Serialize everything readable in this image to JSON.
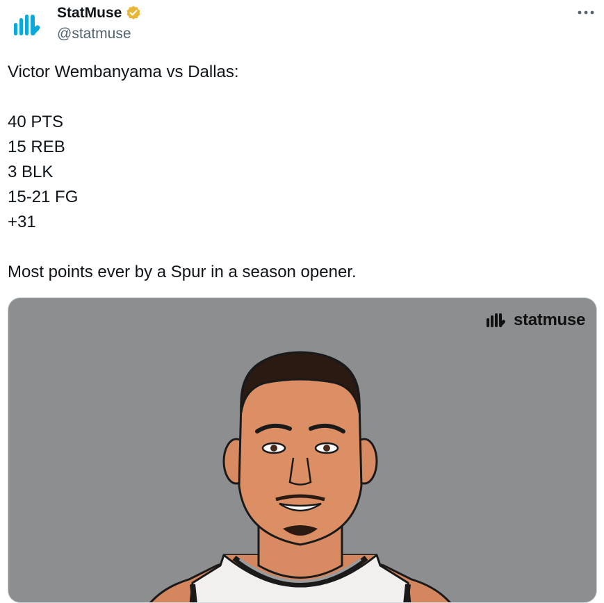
{
  "author": {
    "display_name": "StatMuse",
    "handle": "@statmuse",
    "verified_icon": "verified-badge-icon",
    "avatar_icon": "statmuse-logo-icon",
    "brand_color": "#0ea7d9"
  },
  "menu": {
    "more_icon": "more-horizontal-icon"
  },
  "tweet": {
    "lines": [
      "Victor Wembanyama vs Dallas:",
      "",
      "40 PTS",
      "15 REB",
      "3 BLK",
      "15-21 FG",
      "+31",
      "",
      "Most points ever by a Spur in a season opener."
    ]
  },
  "media": {
    "watermark": "statmuse",
    "background_color": "#8c8e90",
    "image_subject": "player-illustration"
  }
}
